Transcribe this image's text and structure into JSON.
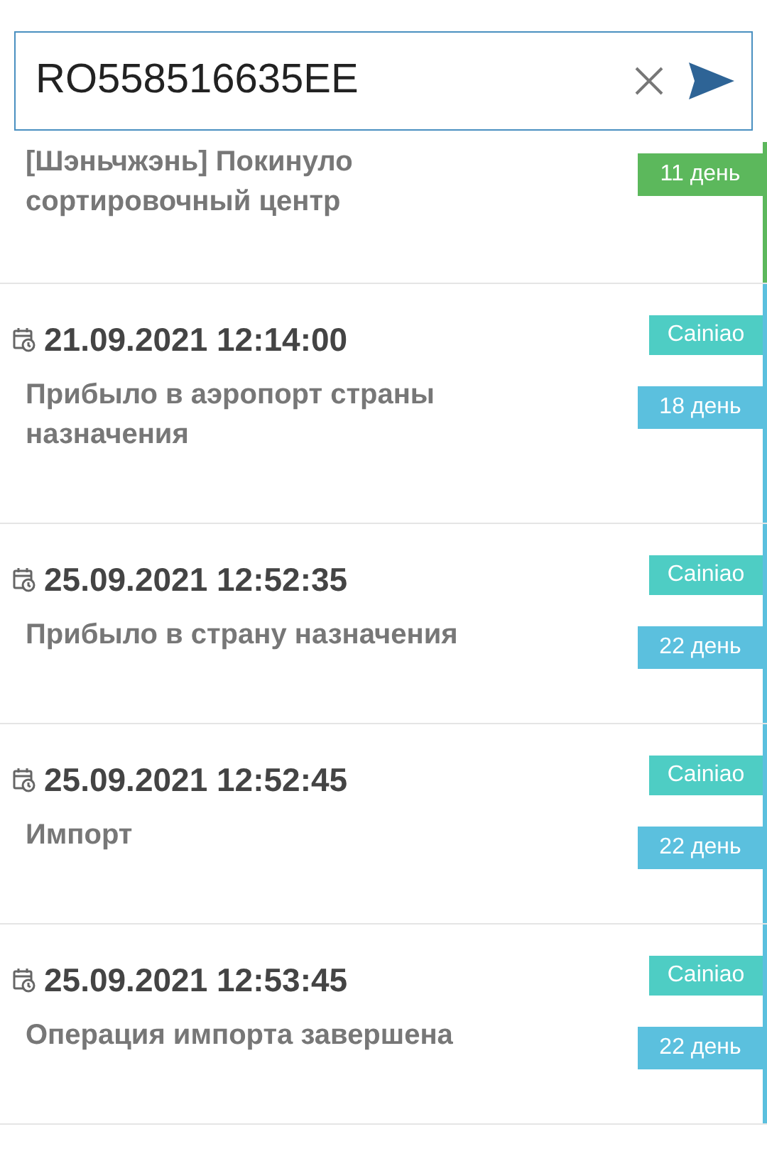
{
  "search": {
    "value": "RO558516635EE"
  },
  "events": [
    {
      "text": "[Шэньчжэнь] Покинуло сортировочный центр",
      "days": "11 день",
      "color": "#5cb85c"
    },
    {
      "date": "21.09.2021 12:14:00",
      "text": "Прибыло в аэропорт страны назначения",
      "carrier": "Cainiao",
      "days": "18 день",
      "color": "#5bc0de"
    },
    {
      "date": "25.09.2021 12:52:35",
      "text": "Прибыло в страну назначения",
      "carrier": "Cainiao",
      "days": "22 день",
      "color": "#5bc0de"
    },
    {
      "date": "25.09.2021 12:52:45",
      "text": "Импорт",
      "carrier": "Cainiao",
      "days": "22 день",
      "color": "#5bc0de"
    },
    {
      "date": "25.09.2021 12:53:45",
      "text": "Операция импорта завершена",
      "carrier": "Cainiao",
      "days": "22 день",
      "color": "#5bc0de"
    }
  ]
}
